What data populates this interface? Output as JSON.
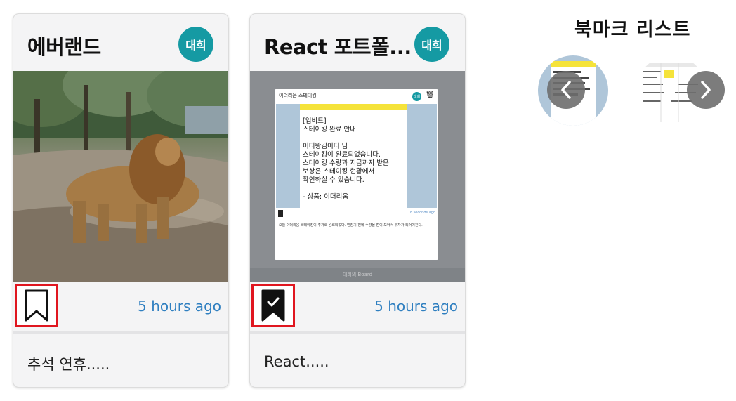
{
  "cards": [
    {
      "title": "에버랜드",
      "badge": "대희",
      "time": "5 hours ago",
      "body": "추석 연휴.....",
      "bookmark_icon": "bookmark-outline-icon",
      "bookmarked": false
    },
    {
      "title": "React 포트폴...",
      "badge": "대희",
      "time": "5 hours ago",
      "body": "React.....",
      "bookmark_icon": "bookmark-check-icon",
      "bookmarked": true,
      "screenshot": {
        "modal_title": "이더리움 스테이킹",
        "badge": "대희",
        "note_text": "[업비트]\n스테이킹 완료 안내\n\n이더왕김이더 님\n스테이킹이 완료되었습니다.\n스테이킹 수량과 지금까지 받은\n보상은 스테이킹 현황에서\n확인하실 수 있습니다.\n\n- 상품: 이더리움",
        "time": "18 seconds ago",
        "desc": "오늘 이더리움 스테이킹이 추가로 완료되었다. 빈칸기 전에 수량을 점이 모아서 투자가 되어어진다.",
        "footer": "대희의 Board"
      }
    }
  ],
  "bookmark_list": {
    "title": "북마크 리스트",
    "prev_icon": "chevron-left-icon",
    "next_icon": "chevron-right-icon"
  },
  "colors": {
    "badge": "#159aa3",
    "time": "#2f7fc0",
    "highlight_border": "#e0161f"
  }
}
